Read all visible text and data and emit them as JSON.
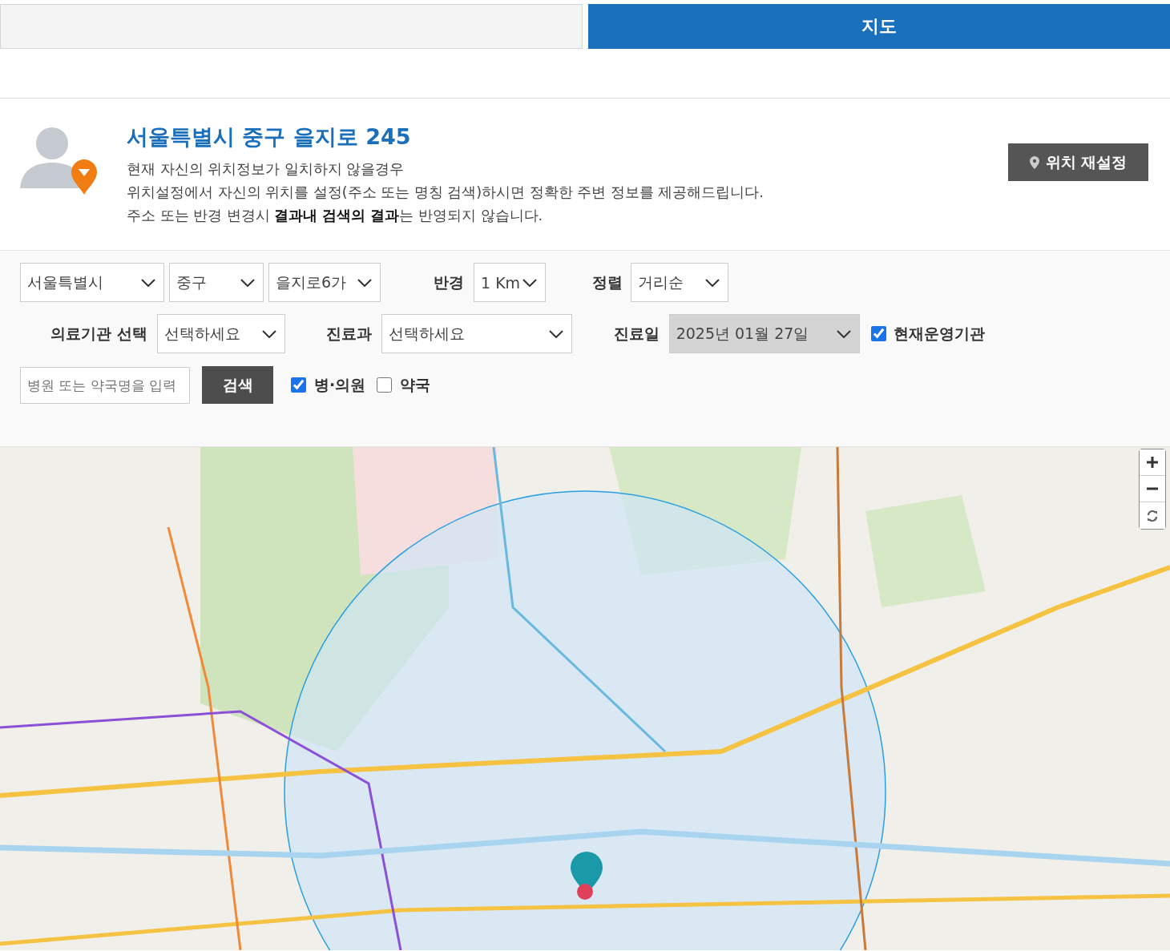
{
  "tabs": [
    {
      "selected": false
    },
    {
      "label": "지도",
      "selected": true
    }
  ],
  "location": {
    "address": "서울특별시 중구 을지로 245",
    "notes": [
      "현재 자신의 위치정보가 일치하지 않을경우",
      "위치설정에서 자신의 위치를 설정(주소 또는 명칭 검색)하시면 정확한 주변 정보를 제공해드립니다.",
      "주소 또는 반경 변경시 **결과내 검색의 결과**는 반영되지 않습니다."
    ],
    "reset_button": "위치 재설정"
  },
  "filters": {
    "region": [
      "서울특별시",
      "중구",
      "을지로6가"
    ],
    "radius": {
      "label": "반경",
      "value": "1 Km"
    },
    "sort": {
      "label": "정렬",
      "value": "거리순"
    },
    "institution": {
      "label": "의료기관 선택",
      "value": "선택하세요"
    },
    "department": {
      "label": "진료과",
      "value": "선택하세요"
    },
    "date": {
      "label": "진료일",
      "value": "2025년 01월 27일",
      "disabled": true
    },
    "open_now": {
      "label": "현재운영기관",
      "checked": true
    }
  },
  "search": {
    "placeholder": "병원 또는 약국명을 입력",
    "button": "검색",
    "types": [
      {
        "label": "병·의원",
        "checked": true
      },
      {
        "label": "약국",
        "checked": false
      }
    ]
  }
}
